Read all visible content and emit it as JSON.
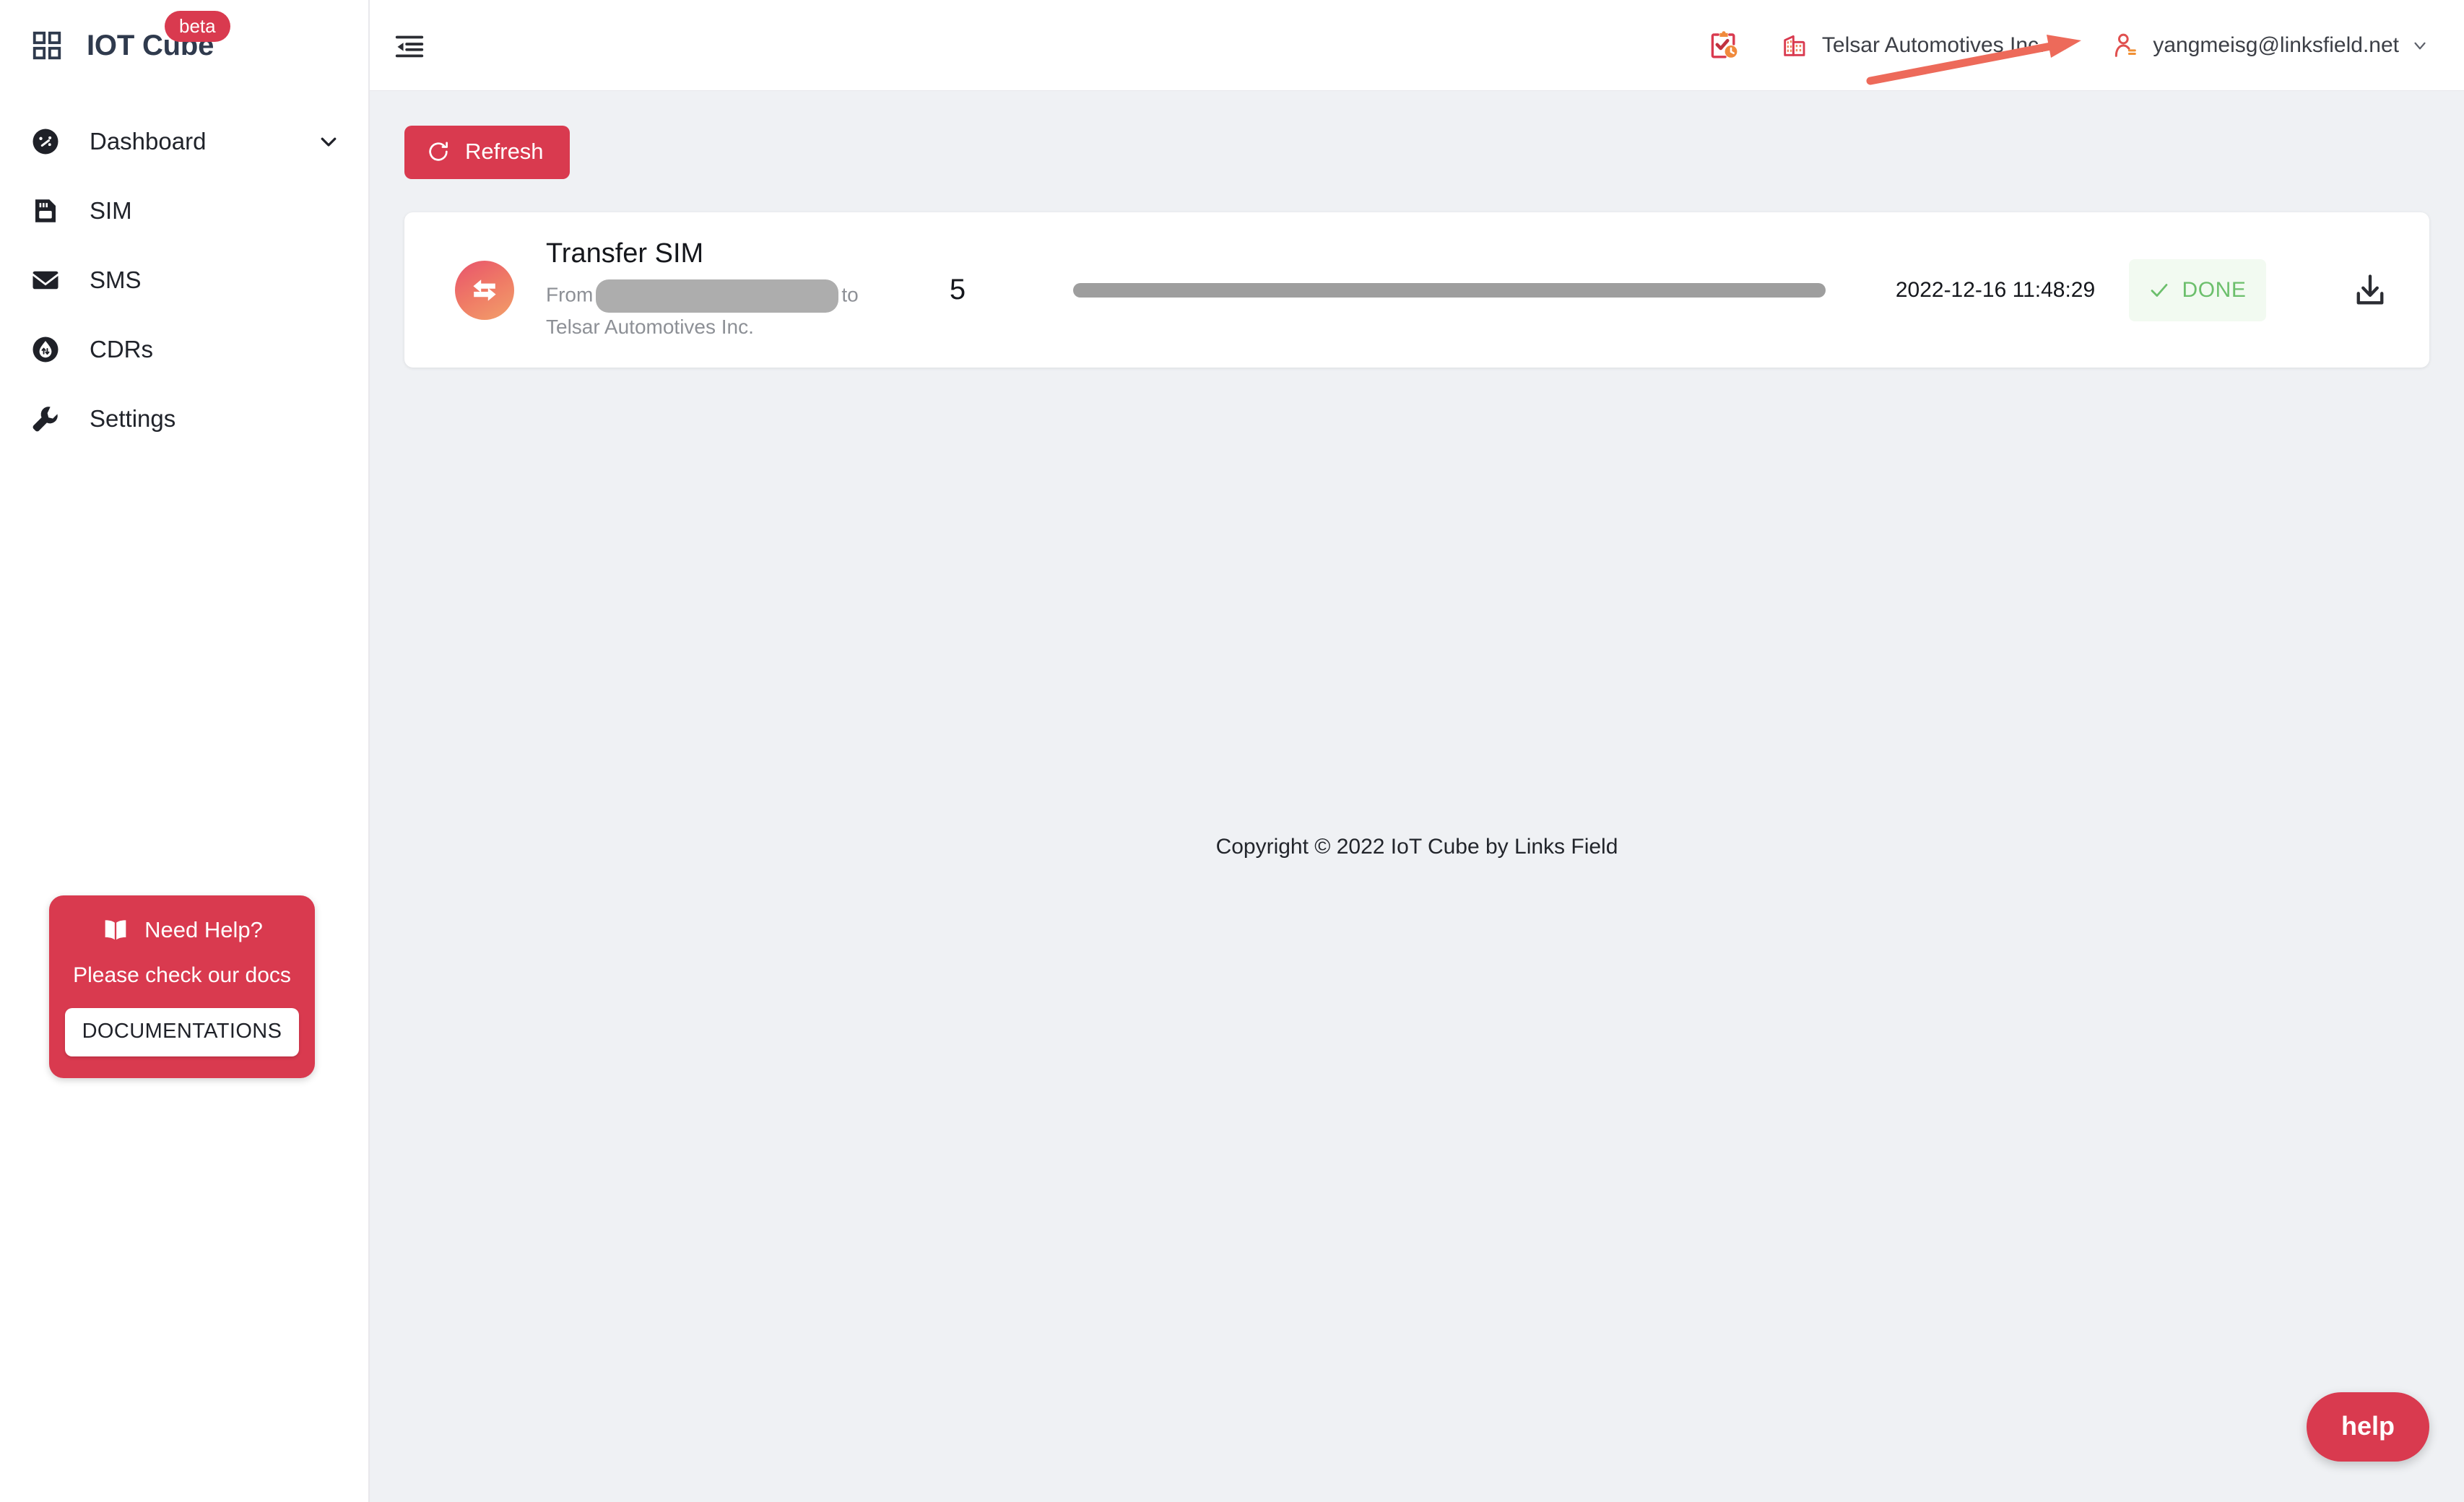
{
  "sidebar": {
    "brand": {
      "name": "IOT Cube",
      "badge": "beta",
      "icon": "grid-icon"
    },
    "items": [
      {
        "label": "Dashboard",
        "icon": "speedometer-icon",
        "expandable": true
      },
      {
        "label": "SIM",
        "icon": "sim-card-icon",
        "expandable": false
      },
      {
        "label": "SMS",
        "icon": "envelope-icon",
        "expandable": false
      },
      {
        "label": "CDRs",
        "icon": "data-drop-icon",
        "expandable": false
      },
      {
        "label": "Settings",
        "icon": "wrench-icon",
        "expandable": false
      }
    ],
    "help_card": {
      "title": "Need Help?",
      "subtitle": "Please check our docs",
      "button": "DOCUMENTATIONS",
      "icon": "book-icon"
    }
  },
  "topbar": {
    "menu_fold_icon": "menu-fold-icon",
    "task_history_icon": "clipboard-check-clock-icon",
    "company": {
      "name": "Telsar Automotives Inc.",
      "icon": "building-icon",
      "caret": "chevron-down-icon"
    },
    "account": {
      "email": "yangmeisg@linksfield.net",
      "icon": "user-icon",
      "caret": "chevron-down-icon"
    }
  },
  "content": {
    "refresh_button": {
      "label": "Refresh",
      "icon": "refresh-icon"
    },
    "tasks": [
      {
        "title": "Transfer SIM",
        "avatar_icon": "transfer-arrows-icon",
        "description_prefix": "From",
        "description_redacted": "",
        "description_middle": "to",
        "description_suffix": "Telsar Automotives Inc.",
        "count": "5",
        "progress_percent": 100,
        "timestamp": "2022-12-16 11:48:29",
        "status": "DONE",
        "status_icon": "check-icon",
        "download_icon": "download-icon"
      }
    ],
    "footer": "Copyright © 2022 IoT Cube by Links Field",
    "help_fab": "help"
  },
  "annotation": {
    "arrow_color": "#ed6a5a",
    "points_to": "task-history-icon"
  },
  "colors": {
    "brand_red": "#d93a4f",
    "logo_navy": "#2f3a4d",
    "content_bg": "#eff1f4",
    "status_green": "#6cbf6c",
    "status_green_bg": "#f2faf1",
    "accent_orange": "#ef7a66"
  }
}
